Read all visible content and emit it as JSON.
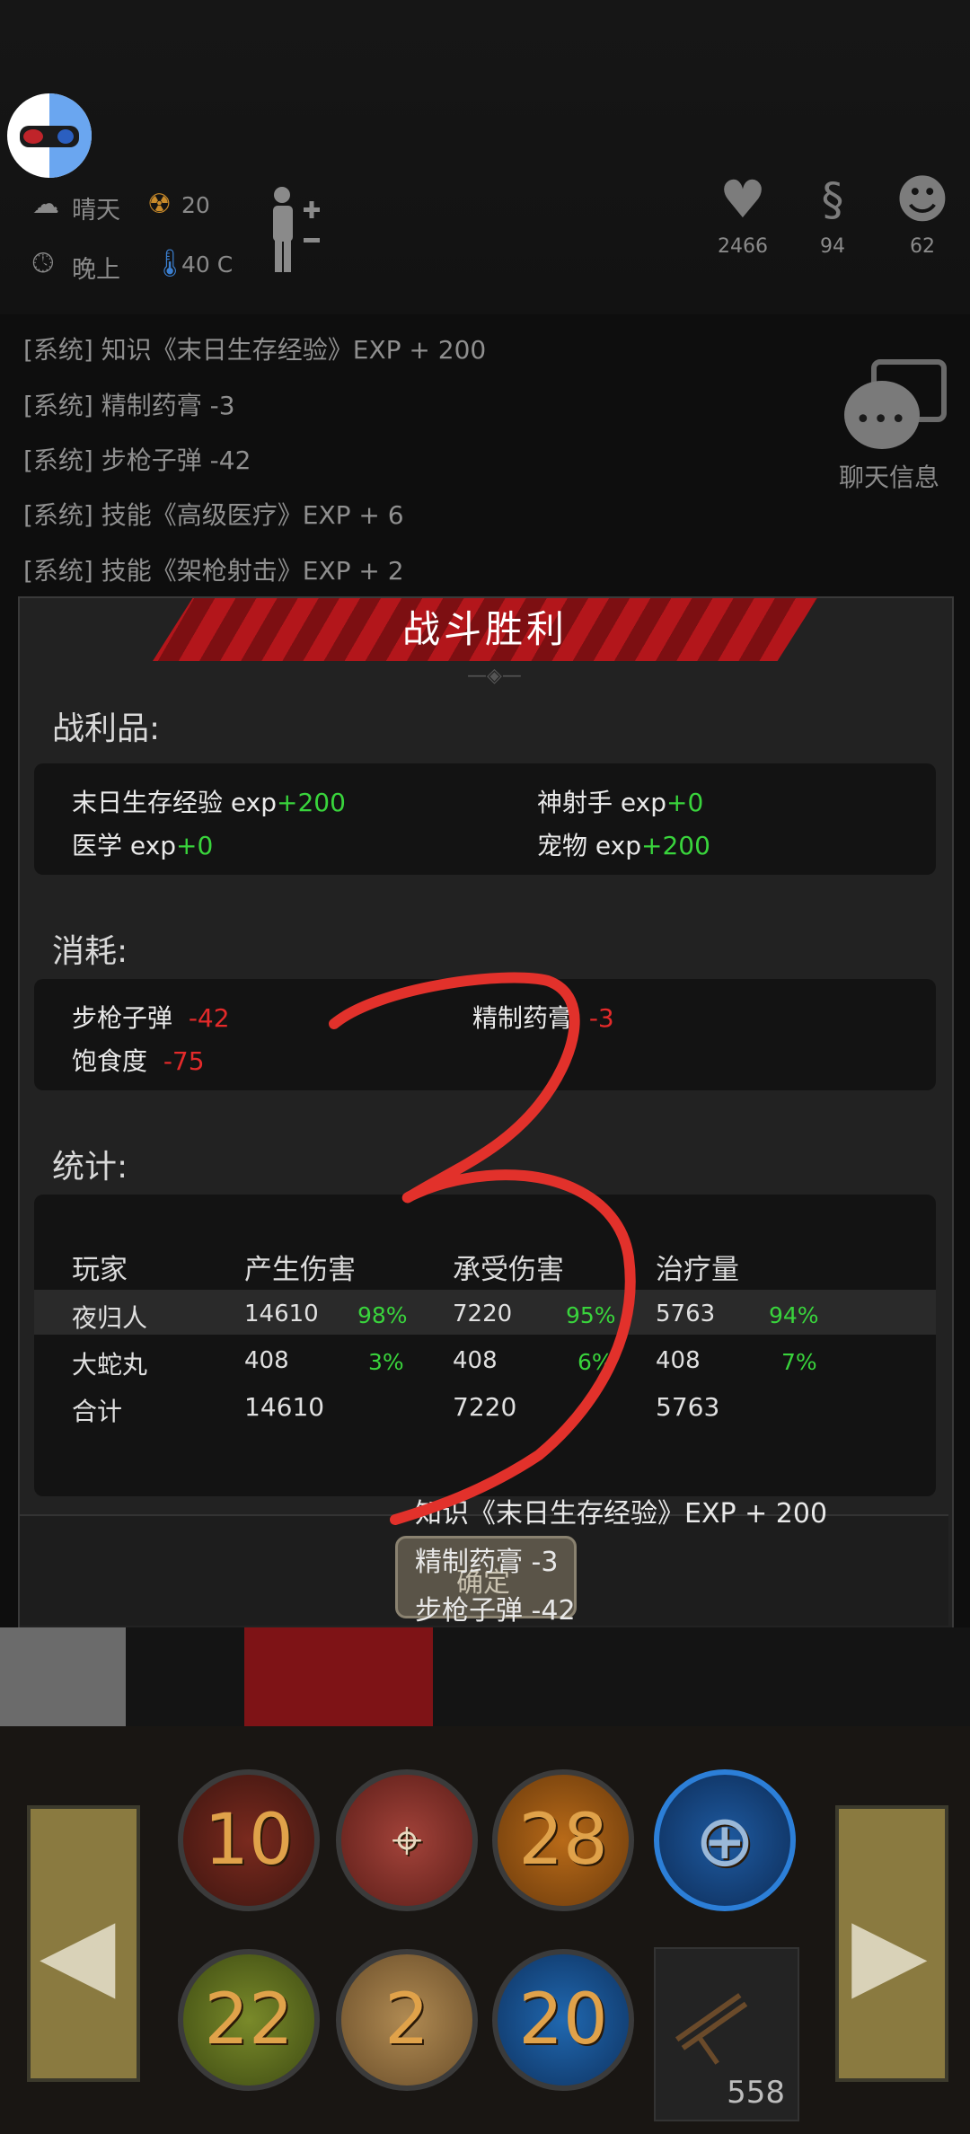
{
  "status": {
    "weather": "晴天",
    "time_of_day": "晚上",
    "radiation": "20",
    "temperature": "40 C",
    "health": "2466",
    "hunger": "94",
    "mind": "62"
  },
  "system_log": [
    "[系统] 知识《末日生存经验》EXP + 200",
    "[系统] 精制药膏 -3",
    "[系统] 步枪子弹 -42",
    "[系统] 技能《高级医疗》EXP + 6",
    "[系统] 技能《架枪射击》EXP + 2"
  ],
  "chat_label": "聊天信息",
  "dialog": {
    "title": "战斗胜利",
    "loot_title": "战利品:",
    "loot": [
      {
        "name": "末日生存经验 exp",
        "value": "+200"
      },
      {
        "name": "神射手 exp",
        "value": "+0"
      },
      {
        "name": "医学 exp",
        "value": "+0"
      },
      {
        "name": "宠物 exp",
        "value": "+200"
      }
    ],
    "consume_title": "消耗:",
    "consume": [
      {
        "name": "步枪子弹",
        "value": "-42"
      },
      {
        "name": "精制药膏",
        "value": "-3"
      },
      {
        "name": "饱食度",
        "value": "-75"
      }
    ],
    "stats_title": "统计:",
    "stats_headers": [
      "玩家",
      "产生伤害",
      "承受伤害",
      "治疗量"
    ],
    "stats_rows": [
      {
        "player": "夜归人",
        "dmg": "14610",
        "dmg_pct": "98%",
        "taken": "7220",
        "taken_pct": "95%",
        "heal": "5763",
        "heal_pct": "94%"
      },
      {
        "player": "大蛇丸",
        "dmg": "408",
        "dmg_pct": "3%",
        "taken": "408",
        "taken_pct": "6%",
        "heal": "408",
        "heal_pct": "7%"
      },
      {
        "player": "合计",
        "dmg": "14610",
        "dmg_pct": "",
        "taken": "7220",
        "taken_pct": "",
        "heal": "5763",
        "heal_pct": ""
      }
    ],
    "confirm_label": "确定",
    "float_log": [
      "知识《末日生存经验》EXP + 200",
      "精制药膏 -3",
      "步枪子弹 -42"
    ]
  },
  "hud": {
    "skills_row1": [
      "10",
      "",
      "28",
      ""
    ],
    "skills_row2": [
      "22",
      "2",
      "20"
    ],
    "ammo": "558"
  },
  "overlay_mark": "3"
}
